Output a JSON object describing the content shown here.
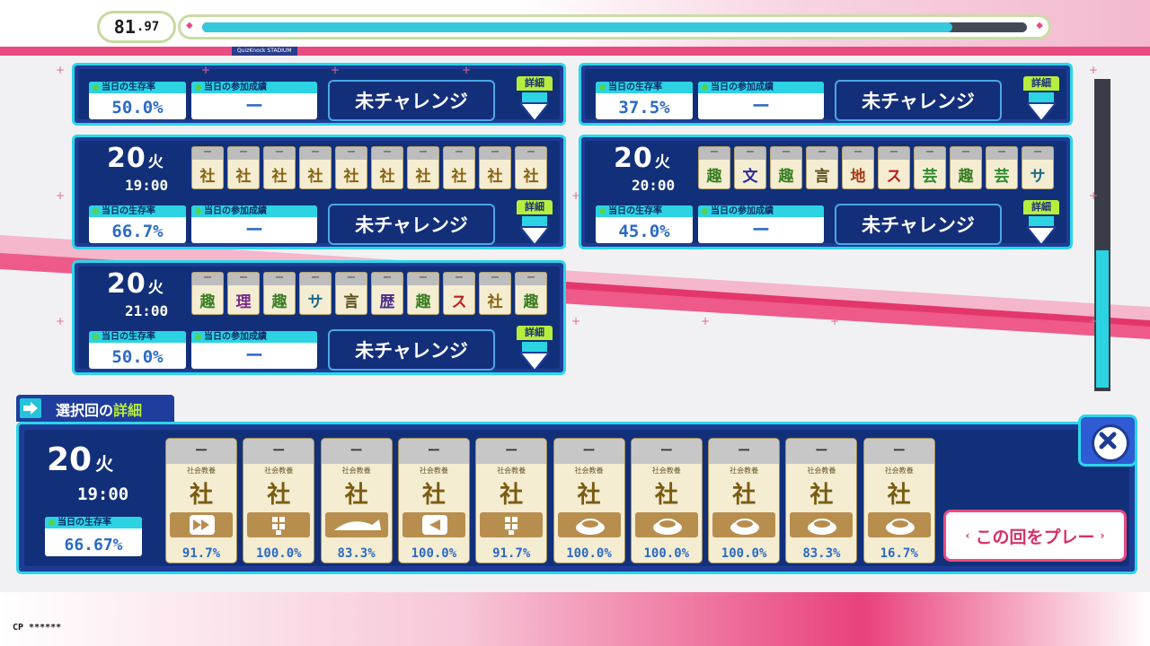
{
  "header": {
    "counter_main": "81",
    "counter_decimal": "97",
    "progress": 0.91,
    "brand": "QuizKnock STADIUM"
  },
  "scroll_progress": 0.35,
  "schedule": [
    {
      "day": "",
      "day_suffix": "",
      "time": "",
      "slots": [],
      "rate": "50.0%",
      "result": "ー",
      "challenge": "未チャレンジ",
      "detail": "詳細"
    },
    {
      "day": "",
      "day_suffix": "",
      "time": "",
      "slots": [],
      "rate": "37.5%",
      "result": "ー",
      "challenge": "未チャレンジ",
      "detail": "詳細"
    },
    {
      "day": "20",
      "day_suffix": "火",
      "time": "19:00",
      "slots": [
        "社",
        "社",
        "社",
        "社",
        "社",
        "社",
        "社",
        "社",
        "社",
        "社"
      ],
      "rate": "66.7%",
      "result": "ー",
      "challenge": "未チャレンジ",
      "detail": "詳細"
    },
    {
      "day": "20",
      "day_suffix": "火",
      "time": "20:00",
      "slots": [
        "趣",
        "文",
        "趣",
        "言",
        "地",
        "ス",
        "芸",
        "趣",
        "芸",
        "サ"
      ],
      "rate": "45.0%",
      "result": "ー",
      "challenge": "未チャレンジ",
      "detail": "詳細"
    },
    {
      "day": "20",
      "day_suffix": "火",
      "time": "21:00",
      "slots": [
        "趣",
        "理",
        "趣",
        "サ",
        "言",
        "歴",
        "趣",
        "ス",
        "社",
        "趣"
      ],
      "rate": "50.0%",
      "result": "ー",
      "challenge": "未チャレンジ",
      "detail": "詳細"
    }
  ],
  "labels": {
    "survival_rate": "当日の生存率",
    "participation": "当日の参加成績"
  },
  "slot_dash": "ー",
  "genre_colors": {
    "社": "#8a6414",
    "趣": "#3a7d22",
    "文": "#2a2a9a",
    "言": "#5a4a1a",
    "地": "#a53a1a",
    "ス": "#c01d1d",
    "芸": "#2e8a2e",
    "サ": "#1e6a8a",
    "理": "#7a2a8a",
    "歴": "#4a2a8a"
  },
  "detail_panel": {
    "title_prefix": "選択回の",
    "title_highlight": "詳細",
    "day": "20",
    "day_suffix": "火",
    "time": "19:00",
    "rate_label": "当日の生存率",
    "rate": "66.67%",
    "questions": [
      {
        "dash": "ー",
        "genre": "社会教養",
        "char": "社",
        "icon": "fast-forward-icon",
        "pct": "91.7%"
      },
      {
        "dash": "ー",
        "genre": "社会教養",
        "char": "社",
        "icon": "puzzle-icon",
        "pct": "100.0%"
      },
      {
        "dash": "ー",
        "genre": "社会教養",
        "char": "社",
        "icon": "rally-icon",
        "pct": "83.3%"
      },
      {
        "dash": "ー",
        "genre": "社会教養",
        "char": "社",
        "icon": "rewind-icon",
        "pct": "100.0%"
      },
      {
        "dash": "ー",
        "genre": "社会教養",
        "char": "社",
        "icon": "puzzle-icon",
        "pct": "91.7%"
      },
      {
        "dash": "ー",
        "genre": "社会教養",
        "char": "社",
        "icon": "buzzer-icon",
        "pct": "100.0%"
      },
      {
        "dash": "ー",
        "genre": "社会教養",
        "char": "社",
        "icon": "buzzer-icon",
        "pct": "100.0%"
      },
      {
        "dash": "ー",
        "genre": "社会教養",
        "char": "社",
        "icon": "buzzer-icon",
        "pct": "100.0%"
      },
      {
        "dash": "ー",
        "genre": "社会教養",
        "char": "社",
        "icon": "buzzer-icon",
        "pct": "83.3%"
      },
      {
        "dash": "ー",
        "genre": "社会教養",
        "char": "社",
        "icon": "buzzer-icon",
        "pct": "16.7%"
      }
    ],
    "play_button": "この回をプレー",
    "close_icon": "close-icon"
  },
  "footer": {
    "cp": "CP ******"
  }
}
